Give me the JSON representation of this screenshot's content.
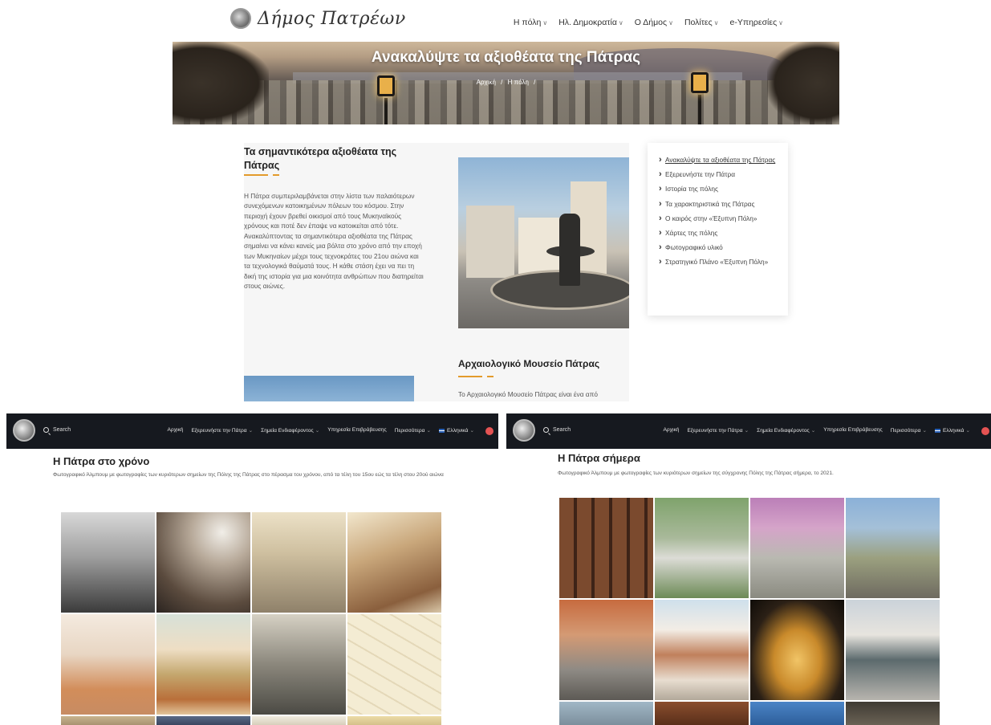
{
  "top": {
    "logo_text": "Δήμος Πατρέων",
    "nav": [
      {
        "label": "Η πόλη"
      },
      {
        "label": "Ηλ. Δημοκρατία"
      },
      {
        "label": "Ο Δήμος"
      },
      {
        "label": "Πολίτες"
      },
      {
        "label": "e-Υπηρεσίες"
      }
    ],
    "hero_title": "Ανακαλύψτε τα αξιοθέατα της Πάτρας",
    "breadcrumb": {
      "home": "Αρχική",
      "sep": "/",
      "current": "Η πόλη"
    },
    "section_title": "Τα σημαντικότερα αξιοθέατα της Πάτρας",
    "section_text": "Η Πάτρα συμπεριλαμβάνεται στην λίστα των παλαιότερων συνεχόμενων κατοικημένων πόλεων του κόσμου. Στην περιοχή έχουν βρεθεί οικισμοί από τους Μυκηναϊκούς χρόνους και ποτέ δεν έπαψε να κατοικείται από τότε. Ανακαλύπτοντας τα σημαντικότερα αξιοθέατα της Πάτρας σημαίνει να κάνει κανείς μια βόλτα στο χρόνο από την εποχή των Μυκηναίων μέχρι τους τεχνοκράτες του 21ου αιώνα και τα τεχνολογικά θαύματά τους. Η κάθε στάση έχει να πει τη δική της ιστορία για μια κοινότητα ανθρώπων που διατηρείται στους αιώνες.",
    "section2_title": "Αρχαιολογικό Μουσείο Πάτρας",
    "section2_text": "Το Αρχαιολογικό Μουσείο Πάτρας είναι ένα από",
    "side_menu": [
      {
        "label": "Ανακαλύψτε τα αξιοθέατα της Πάτρας",
        "active": true
      },
      {
        "label": "Εξερευνήστε την Πάτρα"
      },
      {
        "label": "Ιστορία της πόλης"
      },
      {
        "label": "Τα χαρακτηριστικά της Πάτρας"
      },
      {
        "label": "Ο καιρός στην «Έξυπνη Πόλη»"
      },
      {
        "label": "Χάρτες της πόλης"
      },
      {
        "label": "Φωτογραφικό υλικό"
      },
      {
        "label": "Στρατηγικό Πλάνο «Έξυπνη Πόλη»"
      }
    ]
  },
  "left_shot": {
    "search": "Search",
    "nav": [
      {
        "label": "Αρχική"
      },
      {
        "label": "Εξερευνήστε την Πάτρα"
      },
      {
        "label": "Σημεία Ενδιαφέροντος"
      },
      {
        "label": "Υπηρεσία Επιβράβευσης"
      },
      {
        "label": "Περισσότερα"
      }
    ],
    "language": "Ελληνικά",
    "title": "Η Πάτρα στο χρόνο",
    "description": "Φωτογραφικό Άλμπουμ με φωτογραφίες των κυριότερων σημείων της Πόλης της Πάτρας στο πέρασμα του χρόνου, από τα τέλη του 15ου εώς τα τέλη στου 20ού αιώνα"
  },
  "right_shot": {
    "search": "Search",
    "nav": [
      {
        "label": "Αρχική"
      },
      {
        "label": "Εξερευνήστε την Πάτρα"
      },
      {
        "label": "Σημεία Ενδιαφέροντος"
      },
      {
        "label": "Υπηρεσία Επιβράβευσης"
      },
      {
        "label": "Περισσότερα"
      }
    ],
    "language": "Ελληνικά",
    "title": "Η Πάτρα σήμερα",
    "description": "Φωτογραφικό Άλμπουμ με φωτογραφίες των κυριότερων σημείων της σύγχρονης Πόλης της Πάτρας σήμερα, το 2021."
  },
  "colors": {
    "accent": "#e39b2b",
    "dark_bar": "#16191f",
    "notification": "#e55353"
  }
}
